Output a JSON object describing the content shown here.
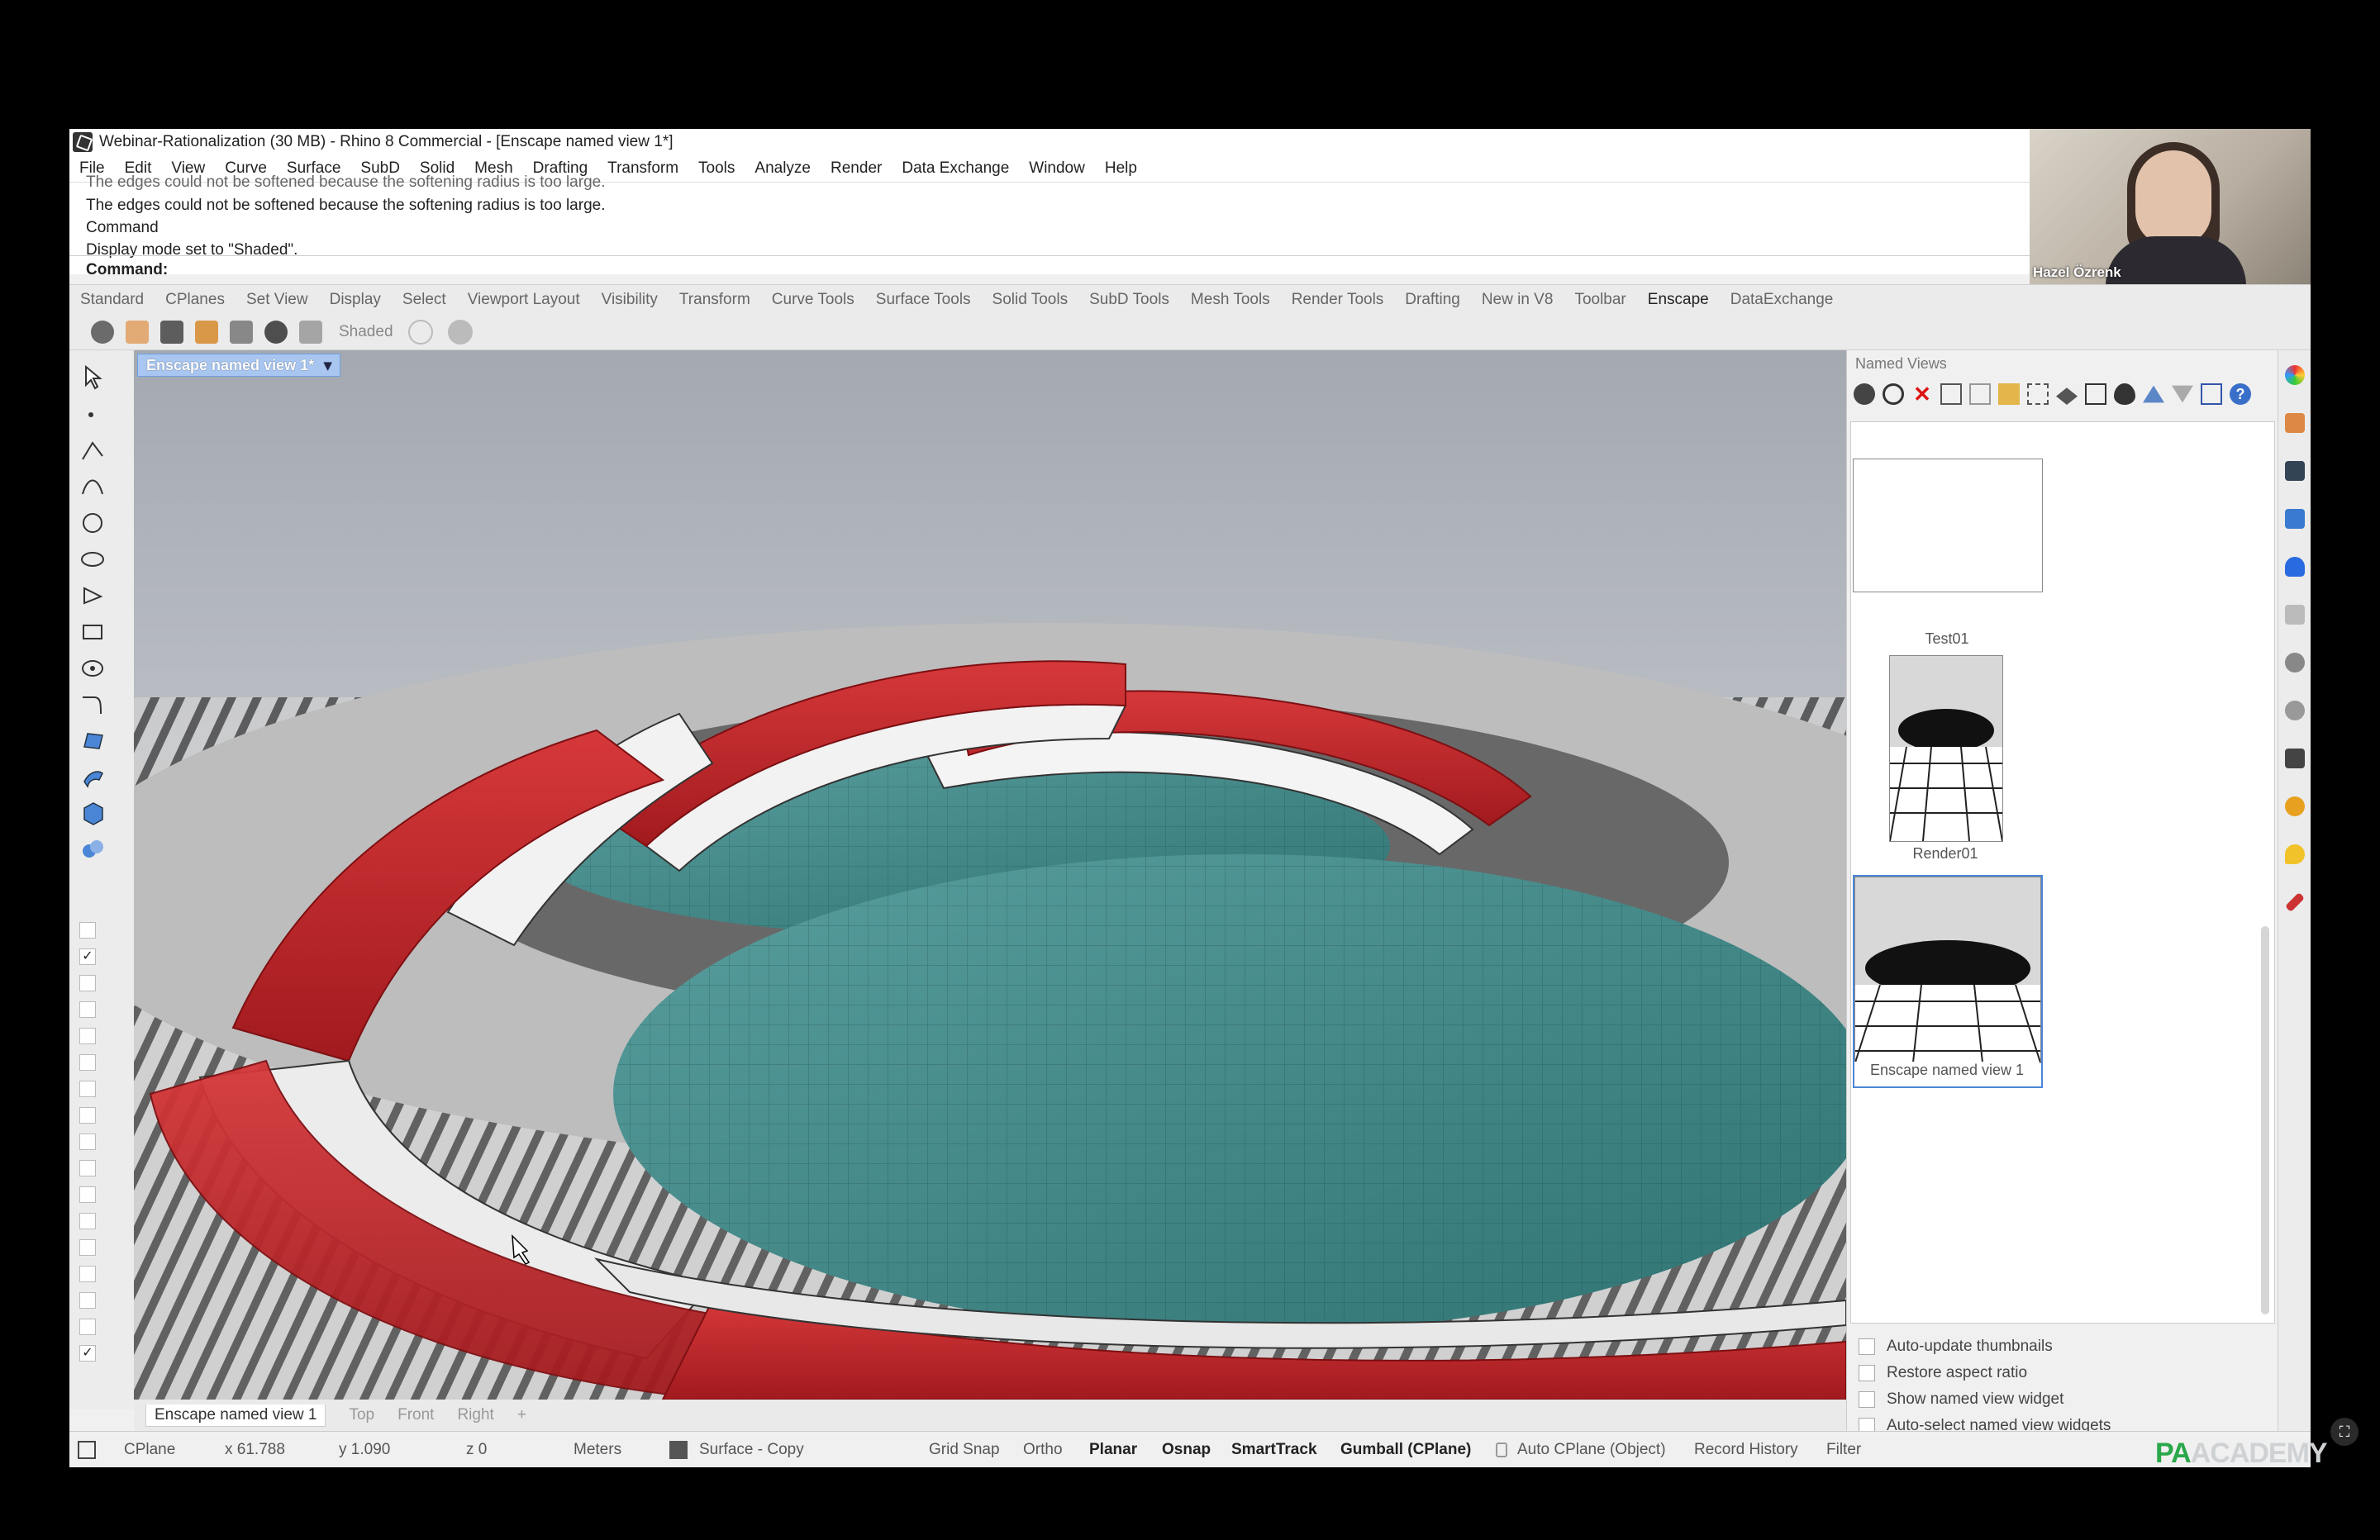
{
  "window": {
    "title": "Webinar-Rationalization (30 MB) - Rhino 8 Commercial - [Enscape named view 1*]"
  },
  "menu": [
    "File",
    "Edit",
    "View",
    "Curve",
    "Surface",
    "SubD",
    "Solid",
    "Mesh",
    "Drafting",
    "Transform",
    "Tools",
    "Analyze",
    "Render",
    "Data Exchange",
    "Window",
    "Help"
  ],
  "command_history": {
    "cut_line": "The edges could not be softened because the softening radius is too large.",
    "lines": [
      "The edges could not be softened because the softening radius is too large.",
      "Command",
      "Display mode set to \"Shaded\"."
    ],
    "prompt": "Command:"
  },
  "webcam": {
    "name": "Hazel Özrenk"
  },
  "toolbar_tabs": [
    "Standard",
    "CPlanes",
    "Set View",
    "Display",
    "Select",
    "Viewport Layout",
    "Visibility",
    "Transform",
    "Curve Tools",
    "Surface Tools",
    "Solid Tools",
    "SubD Tools",
    "Mesh Tools",
    "Render Tools",
    "Drafting",
    "New in V8",
    "Toolbar",
    "Enscape",
    "DataExchange"
  ],
  "active_tab": "Enscape",
  "iconbar": {
    "shaded_label": "Shaded"
  },
  "viewport": {
    "title": "Enscape named view 1*",
    "dropdown": "▾",
    "tabs": [
      "Enscape named view 1",
      "Top",
      "Front",
      "Right"
    ],
    "add_tab": "+"
  },
  "named_views": {
    "title": "Named Views",
    "views": [
      {
        "label": "Test01"
      },
      {
        "label": "Render01"
      },
      {
        "label": "Enscape named view 1"
      }
    ],
    "options": [
      "Auto-update thumbnails",
      "Restore aspect ratio",
      "Show named view widget",
      "Auto-select named view widgets"
    ]
  },
  "statusbar": {
    "cplane": "CPlane",
    "x": "x 61.788",
    "y": "y 1.090",
    "z": "z 0",
    "units": "Meters",
    "layer": "Surface - Copy",
    "grid_snap": "Grid Snap",
    "ortho": "Ortho",
    "planar": "Planar",
    "osnap": "Osnap",
    "smarttrack": "SmartTrack",
    "gumball": "Gumball (CPlane)",
    "auto_cplane": "Auto CPlane (Object)",
    "record_history": "Record History",
    "filter": "Filter"
  },
  "brand": {
    "pa": "PA",
    "academy": "ACADEMY"
  },
  "colors": {
    "accent_blue": "#4b86d6",
    "roof_red": "#c8262a",
    "pool_teal": "#3f8c8c"
  }
}
